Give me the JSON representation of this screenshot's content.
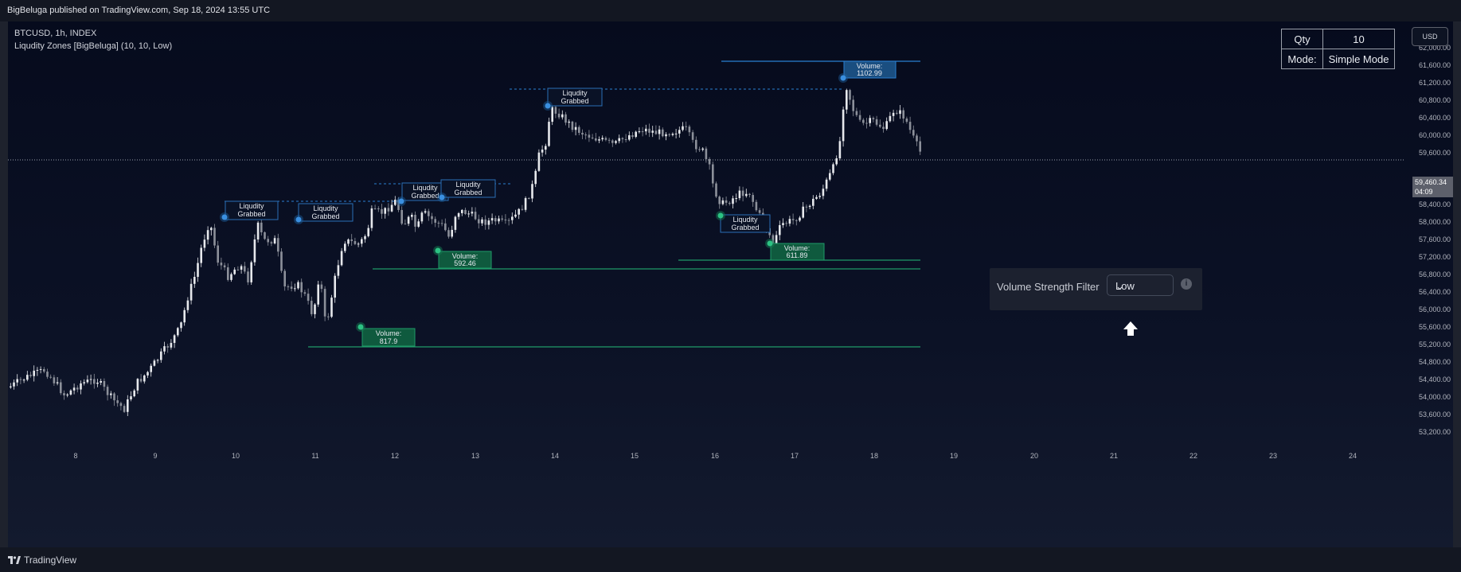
{
  "header": {
    "published_line": "BigBeluga published on TradingView.com, Sep 18, 2024 13:55 UTC"
  },
  "legend": {
    "symbol_line": "BTCUSD, 1h, INDEX",
    "indicator_line": "Liqudity Zones [BigBeluga] (10, 10, Low)"
  },
  "qty_table": {
    "qty_label": "Qty",
    "qty_value": "10",
    "mode_label": "Mode:",
    "mode_value": "Simple Mode"
  },
  "currency_button": "USD",
  "price_axis": {
    "labels": [
      "62,000.00",
      "61,600.00",
      "61,200.00",
      "60,800.00",
      "60,400.00",
      "60,000.00",
      "59,600.00",
      "58,800.00",
      "58,400.00",
      "58,000.00",
      "57,600.00",
      "57,200.00",
      "56,800.00",
      "56,400.00",
      "56,000.00",
      "55,600.00",
      "55,200.00",
      "54,800.00",
      "54,400.00",
      "54,000.00",
      "53,600.00",
      "53,200.00"
    ],
    "last_price": "59,460.34",
    "countdown": "04:09"
  },
  "time_axis": {
    "labels": [
      "8",
      "9",
      "10",
      "11",
      "12",
      "13",
      "14",
      "15",
      "16",
      "17",
      "18",
      "19",
      "20",
      "21",
      "22",
      "23",
      "24"
    ]
  },
  "annotations": {
    "liq_labels": [
      {
        "text1": "Liqudity",
        "text2": "Grabbed"
      },
      {
        "text1": "Liqudity",
        "text2": "Grabbed"
      },
      {
        "text1": "Liqudity",
        "text2": "Grabbed"
      },
      {
        "text1": "Liqudity",
        "text2": "Grabbed"
      },
      {
        "text1": "Liqudity",
        "text2": "Grabbed"
      },
      {
        "text1": "Liqudity",
        "text2": "Grabbed"
      }
    ],
    "volume_labels": [
      {
        "text1": "Volume:",
        "text2": "817.9",
        "kind": "support"
      },
      {
        "text1": "Volume:",
        "text2": "592.46",
        "kind": "support"
      },
      {
        "text1": "Volume:",
        "text2": "611.89",
        "kind": "support"
      },
      {
        "text1": "Volume:",
        "text2": "1102.99",
        "kind": "resistance"
      }
    ]
  },
  "settings_panel": {
    "label": "Volume Strength Filter",
    "selected": "Low",
    "info_icon": "info-icon"
  },
  "footer": {
    "brand": "TradingView"
  },
  "colors": {
    "support": "#1a8a5e",
    "resistance": "#1f5f9e",
    "candle": "#c8cbd2"
  }
}
